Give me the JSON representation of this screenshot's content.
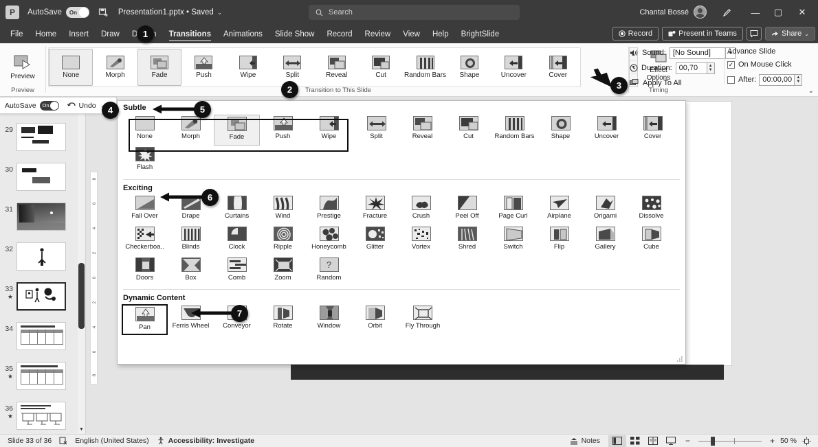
{
  "titlebar": {
    "autosave_label": "AutoSave",
    "autosave_state": "On",
    "document_name": "Presentation1.pptx • Saved",
    "search_placeholder": "Search",
    "account_name": "Chantal Bossé",
    "minimize": "—",
    "maximize": "▢",
    "close": "✕",
    "pen_icon": "pen-icon",
    "logo_letter": "P"
  },
  "tabs": [
    {
      "label": "File",
      "active": false
    },
    {
      "label": "Home",
      "active": false
    },
    {
      "label": "Insert",
      "active": false
    },
    {
      "label": "Draw",
      "active": false
    },
    {
      "label": "Design",
      "active": false
    },
    {
      "label": "Transitions",
      "active": true
    },
    {
      "label": "Animations",
      "active": false
    },
    {
      "label": "Slide Show",
      "active": false
    },
    {
      "label": "Record",
      "active": false
    },
    {
      "label": "Review",
      "active": false
    },
    {
      "label": "View",
      "active": false
    },
    {
      "label": "Help",
      "active": false
    },
    {
      "label": "BrightSlide",
      "active": false
    }
  ],
  "ribbon_right": {
    "record": "Record",
    "present_in_teams": "Present in Teams",
    "comments": "comment-icon",
    "share": "Share"
  },
  "ribbon": {
    "preview_label": "Preview",
    "preview_group_caption": "Preview",
    "transition_group_caption": "Transition to This Slide",
    "effect_options_line1": "Effect",
    "effect_options_line2": "Options",
    "gallery": [
      {
        "name": "None",
        "icon": "none-icon",
        "selected": false
      },
      {
        "name": "Morph",
        "icon": "morph-icon",
        "selected": false
      },
      {
        "name": "Fade",
        "icon": "fade-icon",
        "selected": true
      },
      {
        "name": "Push",
        "icon": "push-icon",
        "selected": false
      },
      {
        "name": "Wipe",
        "icon": "wipe-icon",
        "selected": false
      },
      {
        "name": "Split",
        "icon": "split-icon",
        "selected": false
      },
      {
        "name": "Reveal",
        "icon": "reveal-icon",
        "selected": false
      },
      {
        "name": "Cut",
        "icon": "cut-icon",
        "selected": false
      },
      {
        "name": "Random Bars",
        "icon": "random-bars-icon",
        "selected": false
      },
      {
        "name": "Shape",
        "icon": "shape-icon",
        "selected": false
      },
      {
        "name": "Uncover",
        "icon": "uncover-icon",
        "selected": false
      },
      {
        "name": "Cover",
        "icon": "cover-icon",
        "selected": false
      }
    ]
  },
  "timing": {
    "group_caption": "Timing",
    "sound_label": "Sound:",
    "sound_value": "[No Sound]",
    "duration_label": "Duration:",
    "duration_value": "00,70",
    "apply_to_all": "Apply To All",
    "advance_slide_label": "Advance Slide",
    "on_mouse_click": "On Mouse Click",
    "on_mouse_click_checked": true,
    "after_label": "After:",
    "after_value": "00:00,00",
    "after_checked": false
  },
  "mini_toolbar": {
    "autosave_label": "AutoSave",
    "autosave_state": "On",
    "undo_label": "Undo"
  },
  "dropdown": {
    "sections": [
      {
        "title": "Subtle",
        "items": [
          {
            "name": "None",
            "icon": "none-icon",
            "selected": false
          },
          {
            "name": "Morph",
            "icon": "morph-icon",
            "selected": false
          },
          {
            "name": "Fade",
            "icon": "fade-icon",
            "selected": true
          },
          {
            "name": "Push",
            "icon": "push-icon",
            "selected": false
          },
          {
            "name": "Wipe",
            "icon": "wipe-icon",
            "selected": false
          },
          {
            "name": "Split",
            "icon": "split-icon",
            "selected": false
          },
          {
            "name": "Reveal",
            "icon": "reveal-icon",
            "selected": false
          },
          {
            "name": "Cut",
            "icon": "cut-icon",
            "selected": false
          },
          {
            "name": "Random Bars",
            "icon": "random-bars-icon",
            "selected": false
          },
          {
            "name": "Shape",
            "icon": "shape-icon",
            "selected": false
          },
          {
            "name": "Uncover",
            "icon": "uncover-icon",
            "selected": false
          },
          {
            "name": "Cover",
            "icon": "cover-icon",
            "selected": false
          },
          {
            "name": "Flash",
            "icon": "flash-icon",
            "selected": false
          }
        ]
      },
      {
        "title": "Exciting",
        "items": [
          {
            "name": "Fall Over",
            "icon": "fall-over-icon",
            "selected": false
          },
          {
            "name": "Drape",
            "icon": "drape-icon",
            "selected": false
          },
          {
            "name": "Curtains",
            "icon": "curtains-icon",
            "selected": false
          },
          {
            "name": "Wind",
            "icon": "wind-icon",
            "selected": false
          },
          {
            "name": "Prestige",
            "icon": "prestige-icon",
            "selected": false
          },
          {
            "name": "Fracture",
            "icon": "fracture-icon",
            "selected": false
          },
          {
            "name": "Crush",
            "icon": "crush-icon",
            "selected": false
          },
          {
            "name": "Peel Off",
            "icon": "peel-off-icon",
            "selected": false
          },
          {
            "name": "Page Curl",
            "icon": "page-curl-icon",
            "selected": false
          },
          {
            "name": "Airplane",
            "icon": "airplane-icon",
            "selected": false
          },
          {
            "name": "Origami",
            "icon": "origami-icon",
            "selected": false
          },
          {
            "name": "Dissolve",
            "icon": "dissolve-icon",
            "selected": false
          },
          {
            "name": "Checkerboa..",
            "icon": "checkerboard-icon",
            "selected": false
          },
          {
            "name": "Blinds",
            "icon": "blinds-icon",
            "selected": false
          },
          {
            "name": "Clock",
            "icon": "clock-icon",
            "selected": false
          },
          {
            "name": "Ripple",
            "icon": "ripple-icon",
            "selected": false
          },
          {
            "name": "Honeycomb",
            "icon": "honeycomb-icon",
            "selected": false
          },
          {
            "name": "Glitter",
            "icon": "glitter-icon",
            "selected": false
          },
          {
            "name": "Vortex",
            "icon": "vortex-icon",
            "selected": false
          },
          {
            "name": "Shred",
            "icon": "shred-icon",
            "selected": false
          },
          {
            "name": "Switch",
            "icon": "switch-icon",
            "selected": false
          },
          {
            "name": "Flip",
            "icon": "flip-icon",
            "selected": false
          },
          {
            "name": "Gallery",
            "icon": "gallery-icon",
            "selected": false
          },
          {
            "name": "Cube",
            "icon": "cube-icon",
            "selected": false
          },
          {
            "name": "Doors",
            "icon": "doors-icon",
            "selected": false
          },
          {
            "name": "Box",
            "icon": "box-icon",
            "selected": false
          },
          {
            "name": "Comb",
            "icon": "comb-icon",
            "selected": false
          },
          {
            "name": "Zoom",
            "icon": "zoom-icon",
            "selected": false
          },
          {
            "name": "Random",
            "icon": "random-icon",
            "selected": false
          }
        ]
      },
      {
        "title": "Dynamic Content",
        "items": [
          {
            "name": "Pan",
            "icon": "pan-icon",
            "selected": true
          },
          {
            "name": "Ferris Wheel",
            "icon": "ferris-wheel-icon",
            "selected": false
          },
          {
            "name": "Conveyor",
            "icon": "conveyor-icon",
            "selected": false
          },
          {
            "name": "Rotate",
            "icon": "rotate-icon",
            "selected": false
          },
          {
            "name": "Window",
            "icon": "window-icon",
            "selected": false
          },
          {
            "name": "Orbit",
            "icon": "orbit-icon",
            "selected": false
          },
          {
            "name": "Fly Through",
            "icon": "fly-through-icon",
            "selected": false
          }
        ]
      }
    ]
  },
  "slides": [
    {
      "number": "29",
      "star": false,
      "current": false,
      "kind": "text-blocks"
    },
    {
      "number": "30",
      "star": false,
      "current": false,
      "kind": "text-two"
    },
    {
      "number": "31",
      "star": false,
      "current": false,
      "kind": "photo"
    },
    {
      "number": "32",
      "star": false,
      "current": false,
      "kind": "figure"
    },
    {
      "number": "33",
      "star": true,
      "current": true,
      "kind": "people"
    },
    {
      "number": "34",
      "star": false,
      "current": false,
      "kind": "table"
    },
    {
      "number": "35",
      "star": true,
      "current": false,
      "kind": "table"
    },
    {
      "number": "36",
      "star": true,
      "current": false,
      "kind": "diagram"
    }
  ],
  "ruler": {
    "labels": [
      "8",
      "6",
      "4",
      "2",
      "0",
      "2",
      "4",
      "6",
      "8"
    ]
  },
  "statusbar": {
    "slide_counter": "Slide 33 of 36",
    "accessibility_icon": "accessibility-check-icon",
    "language": "English (United States)",
    "accessibility": "Accessibility: Investigate",
    "notes": "Notes",
    "views": [
      "normal-view-icon",
      "slide-sorter-icon",
      "reading-view-icon",
      "slideshow-icon"
    ],
    "zoom_out": "−",
    "zoom_in": "+",
    "zoom_level": "50 %",
    "fit_icon": "fit-to-window-icon"
  },
  "callouts": [
    {
      "n": "1"
    },
    {
      "n": "2"
    },
    {
      "n": "3"
    },
    {
      "n": "4"
    },
    {
      "n": "5"
    },
    {
      "n": "6"
    },
    {
      "n": "7"
    }
  ]
}
